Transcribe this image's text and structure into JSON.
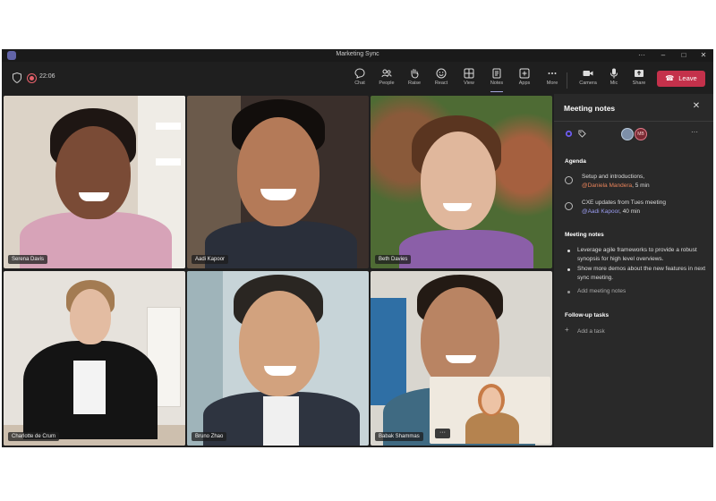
{
  "window": {
    "title": "Marketing Sync"
  },
  "window_controls": {
    "more": "···",
    "minimize": "–",
    "maximize": "□",
    "close": "✕"
  },
  "meeting": {
    "timer": "22:06"
  },
  "toolbar": {
    "buttons": [
      {
        "label": "Chat",
        "icon": "chat-icon"
      },
      {
        "label": "People",
        "icon": "people-icon"
      },
      {
        "label": "Raise",
        "icon": "hand-icon"
      },
      {
        "label": "React",
        "icon": "smile-icon"
      },
      {
        "label": "View",
        "icon": "grid-icon"
      },
      {
        "label": "Notes",
        "icon": "notes-icon",
        "active": true
      },
      {
        "label": "Apps",
        "icon": "apps-icon"
      },
      {
        "label": "More",
        "icon": "more-icon"
      },
      {
        "label": "Camera",
        "icon": "camera-icon"
      },
      {
        "label": "Mic",
        "icon": "mic-icon"
      },
      {
        "label": "Share",
        "icon": "share-icon"
      }
    ],
    "leave_label": "Leave"
  },
  "participants": [
    {
      "name": "Serena Davis"
    },
    {
      "name": "Aadi Kapoor"
    },
    {
      "name": "Beth Davies"
    },
    {
      "name": "Charlotte de Crum"
    },
    {
      "name": "Bruno Zhao"
    },
    {
      "name": "Babak Shammas"
    }
  ],
  "overflow_button": "···",
  "notes_panel": {
    "title": "Meeting notes",
    "close": "✕",
    "more": "···",
    "avatar_initials": "MB",
    "agenda": {
      "heading": "Agenda",
      "items": [
        {
          "text": "Setup and introductions,",
          "mention": "@Daniela Mandera",
          "duration": ", 5 min"
        },
        {
          "text": "CXE updates from Tues meeting",
          "mention": "@Aadi Kapoor",
          "duration": ", 40 min"
        }
      ]
    },
    "notes": {
      "heading": "Meeting notes",
      "items": [
        "Leverage agile frameworks to provide a robust synopsis for high level overviews.",
        "Show more demos about the new features in next sync meeting."
      ],
      "add_label": "Add meeting notes"
    },
    "tasks": {
      "heading": "Follow-up tasks",
      "add_label": "Add a task"
    }
  },
  "colors": {
    "leave": "#c4314b",
    "accent": "#6264a7",
    "mention_orange": "#e8835a",
    "mention_purple": "#9a9cf0"
  }
}
